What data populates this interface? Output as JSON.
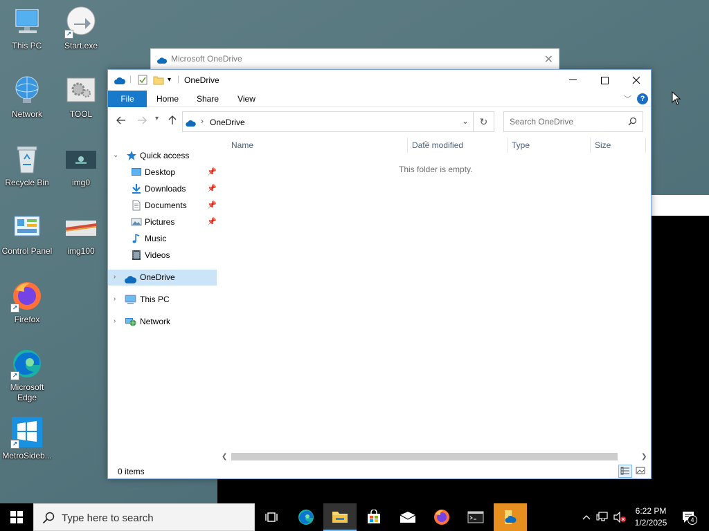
{
  "desktop": {
    "icons": [
      {
        "label": "This PC"
      },
      {
        "label": "Start.exe"
      },
      {
        "label": "Network"
      },
      {
        "label": "TOOL"
      },
      {
        "label": "Recycle Bin"
      },
      {
        "label": "img0"
      },
      {
        "label": "Control Panel"
      },
      {
        "label": "img100"
      },
      {
        "label": "Firefox"
      },
      {
        "label": "Microsoft Edge"
      },
      {
        "label": "MetroSideb..."
      }
    ]
  },
  "background_window": {
    "title": "Microsoft OneDrive"
  },
  "explorer": {
    "title": "OneDrive",
    "ribbon_tabs": [
      "File",
      "Home",
      "Share",
      "View"
    ],
    "address_path": "OneDrive",
    "search_placeholder": "Search OneDrive",
    "nav": {
      "quick_access": "Quick access",
      "quick_items": [
        "Desktop",
        "Downloads",
        "Documents",
        "Pictures",
        "Music",
        "Videos"
      ],
      "onedrive": "OneDrive",
      "this_pc": "This PC",
      "network": "Network"
    },
    "columns": [
      "Name",
      "Date modified",
      "Type",
      "Size"
    ],
    "empty_message": "This folder is empty.",
    "status": "0 items"
  },
  "taskbar": {
    "search_text": "Type here to search",
    "time": "6:22 PM",
    "date": "1/2/2025",
    "notification_count": "4"
  },
  "colors": {
    "accent": "#1979ca",
    "selection": "#cce4f7",
    "onedrive_blue": "#0f6cbd",
    "taskbar": "#000000"
  }
}
